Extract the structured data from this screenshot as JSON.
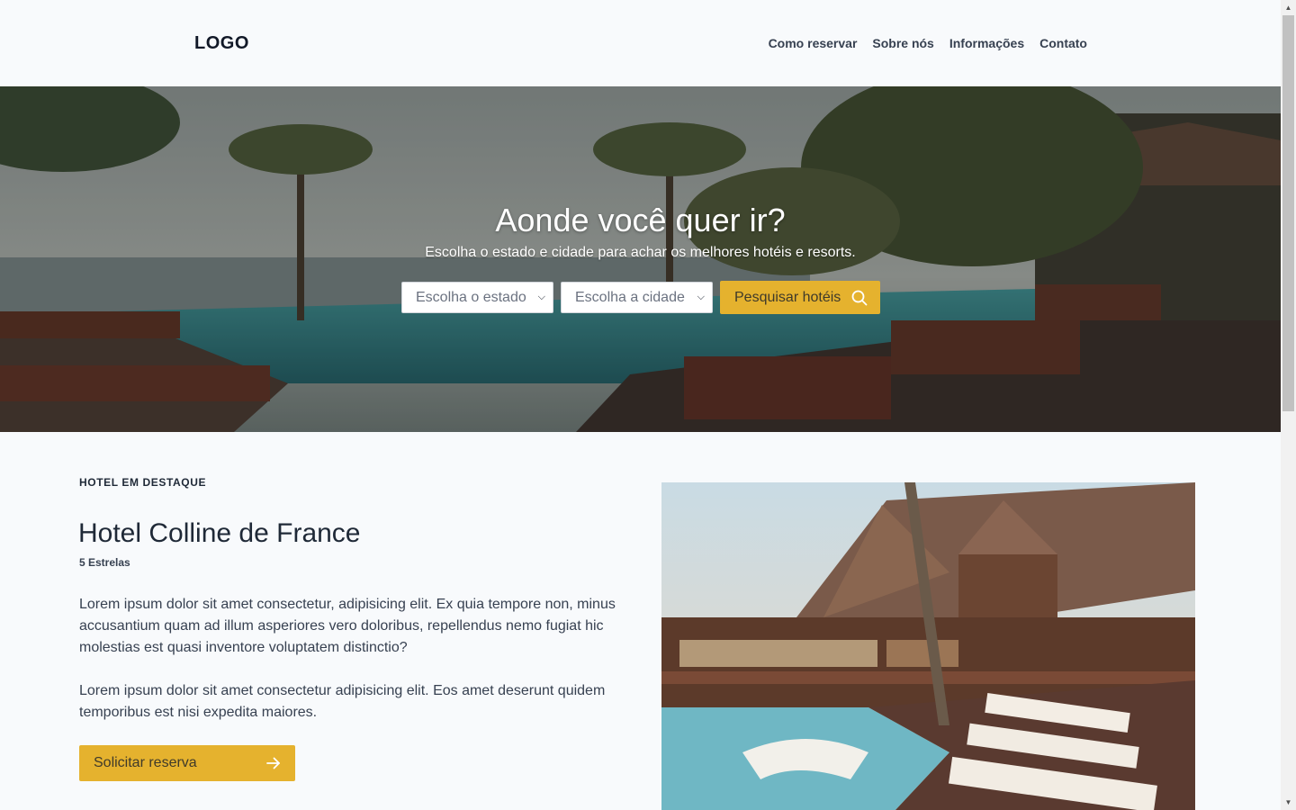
{
  "header": {
    "logo": "LOGO",
    "nav": [
      "Como reservar",
      "Sobre nós",
      "Informações",
      "Contato"
    ]
  },
  "hero": {
    "title": "Aonde você quer ir?",
    "subtitle": "Escolha o estado e cidade para achar os melhores hotéis e resorts.",
    "state_select": "Escolha o estado",
    "city_select": "Escolha a cidade",
    "search_button": "Pesquisar hotéis"
  },
  "featured": {
    "kicker": "HOTEL EM DESTAQUE",
    "name": "Hotel Colline de France",
    "stars": "5 Estrelas",
    "paragraph1": "Lorem ipsum dolor sit amet consectetur, adipisicing elit. Ex quia tempore non, minus accusantium quam ad illum asperiores vero doloribus, repellendus nemo fugiat hic molestias est quasi inventore voluptatem distinctio?",
    "paragraph2": "Lorem ipsum dolor sit amet consectetur adipisicing elit. Eos amet deserunt quidem temporibus est nisi expedita maiores.",
    "reserve_button": "Solicitar reserva"
  },
  "colors": {
    "accent": "#e5b22e",
    "background": "#f8fafc",
    "text": "#1f2937"
  },
  "icons": {
    "search": "search-icon",
    "arrow": "arrow-right-icon",
    "select_chevron": "chevron-down-icon"
  }
}
